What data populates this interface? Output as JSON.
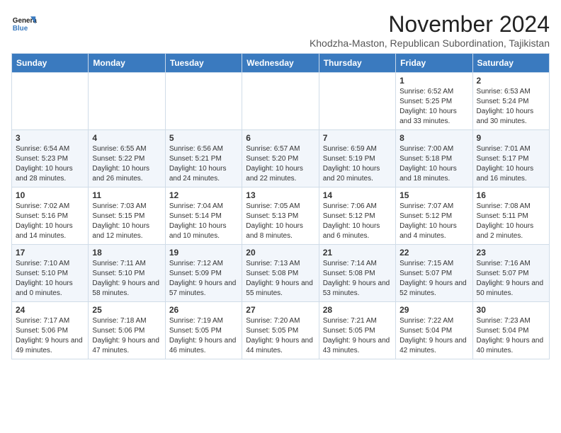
{
  "header": {
    "logo_line1": "General",
    "logo_line2": "Blue",
    "month": "November 2024",
    "location": "Khodzha-Maston, Republican Subordination, Tajikistan"
  },
  "weekdays": [
    "Sunday",
    "Monday",
    "Tuesday",
    "Wednesday",
    "Thursday",
    "Friday",
    "Saturday"
  ],
  "weeks": [
    [
      {
        "day": "",
        "info": ""
      },
      {
        "day": "",
        "info": ""
      },
      {
        "day": "",
        "info": ""
      },
      {
        "day": "",
        "info": ""
      },
      {
        "day": "",
        "info": ""
      },
      {
        "day": "1",
        "info": "Sunrise: 6:52 AM\nSunset: 5:25 PM\nDaylight: 10 hours\nand 33 minutes."
      },
      {
        "day": "2",
        "info": "Sunrise: 6:53 AM\nSunset: 5:24 PM\nDaylight: 10 hours\nand 30 minutes."
      }
    ],
    [
      {
        "day": "3",
        "info": "Sunrise: 6:54 AM\nSunset: 5:23 PM\nDaylight: 10 hours\nand 28 minutes."
      },
      {
        "day": "4",
        "info": "Sunrise: 6:55 AM\nSunset: 5:22 PM\nDaylight: 10 hours\nand 26 minutes."
      },
      {
        "day": "5",
        "info": "Sunrise: 6:56 AM\nSunset: 5:21 PM\nDaylight: 10 hours\nand 24 minutes."
      },
      {
        "day": "6",
        "info": "Sunrise: 6:57 AM\nSunset: 5:20 PM\nDaylight: 10 hours\nand 22 minutes."
      },
      {
        "day": "7",
        "info": "Sunrise: 6:59 AM\nSunset: 5:19 PM\nDaylight: 10 hours\nand 20 minutes."
      },
      {
        "day": "8",
        "info": "Sunrise: 7:00 AM\nSunset: 5:18 PM\nDaylight: 10 hours\nand 18 minutes."
      },
      {
        "day": "9",
        "info": "Sunrise: 7:01 AM\nSunset: 5:17 PM\nDaylight: 10 hours\nand 16 minutes."
      }
    ],
    [
      {
        "day": "10",
        "info": "Sunrise: 7:02 AM\nSunset: 5:16 PM\nDaylight: 10 hours\nand 14 minutes."
      },
      {
        "day": "11",
        "info": "Sunrise: 7:03 AM\nSunset: 5:15 PM\nDaylight: 10 hours\nand 12 minutes."
      },
      {
        "day": "12",
        "info": "Sunrise: 7:04 AM\nSunset: 5:14 PM\nDaylight: 10 hours\nand 10 minutes."
      },
      {
        "day": "13",
        "info": "Sunrise: 7:05 AM\nSunset: 5:13 PM\nDaylight: 10 hours\nand 8 minutes."
      },
      {
        "day": "14",
        "info": "Sunrise: 7:06 AM\nSunset: 5:12 PM\nDaylight: 10 hours\nand 6 minutes."
      },
      {
        "day": "15",
        "info": "Sunrise: 7:07 AM\nSunset: 5:12 PM\nDaylight: 10 hours\nand 4 minutes."
      },
      {
        "day": "16",
        "info": "Sunrise: 7:08 AM\nSunset: 5:11 PM\nDaylight: 10 hours\nand 2 minutes."
      }
    ],
    [
      {
        "day": "17",
        "info": "Sunrise: 7:10 AM\nSunset: 5:10 PM\nDaylight: 10 hours\nand 0 minutes."
      },
      {
        "day": "18",
        "info": "Sunrise: 7:11 AM\nSunset: 5:10 PM\nDaylight: 9 hours\nand 58 minutes."
      },
      {
        "day": "19",
        "info": "Sunrise: 7:12 AM\nSunset: 5:09 PM\nDaylight: 9 hours\nand 57 minutes."
      },
      {
        "day": "20",
        "info": "Sunrise: 7:13 AM\nSunset: 5:08 PM\nDaylight: 9 hours\nand 55 minutes."
      },
      {
        "day": "21",
        "info": "Sunrise: 7:14 AM\nSunset: 5:08 PM\nDaylight: 9 hours\nand 53 minutes."
      },
      {
        "day": "22",
        "info": "Sunrise: 7:15 AM\nSunset: 5:07 PM\nDaylight: 9 hours\nand 52 minutes."
      },
      {
        "day": "23",
        "info": "Sunrise: 7:16 AM\nSunset: 5:07 PM\nDaylight: 9 hours\nand 50 minutes."
      }
    ],
    [
      {
        "day": "24",
        "info": "Sunrise: 7:17 AM\nSunset: 5:06 PM\nDaylight: 9 hours\nand 49 minutes."
      },
      {
        "day": "25",
        "info": "Sunrise: 7:18 AM\nSunset: 5:06 PM\nDaylight: 9 hours\nand 47 minutes."
      },
      {
        "day": "26",
        "info": "Sunrise: 7:19 AM\nSunset: 5:05 PM\nDaylight: 9 hours\nand 46 minutes."
      },
      {
        "day": "27",
        "info": "Sunrise: 7:20 AM\nSunset: 5:05 PM\nDaylight: 9 hours\nand 44 minutes."
      },
      {
        "day": "28",
        "info": "Sunrise: 7:21 AM\nSunset: 5:05 PM\nDaylight: 9 hours\nand 43 minutes."
      },
      {
        "day": "29",
        "info": "Sunrise: 7:22 AM\nSunset: 5:04 PM\nDaylight: 9 hours\nand 42 minutes."
      },
      {
        "day": "30",
        "info": "Sunrise: 7:23 AM\nSunset: 5:04 PM\nDaylight: 9 hours\nand 40 minutes."
      }
    ]
  ]
}
